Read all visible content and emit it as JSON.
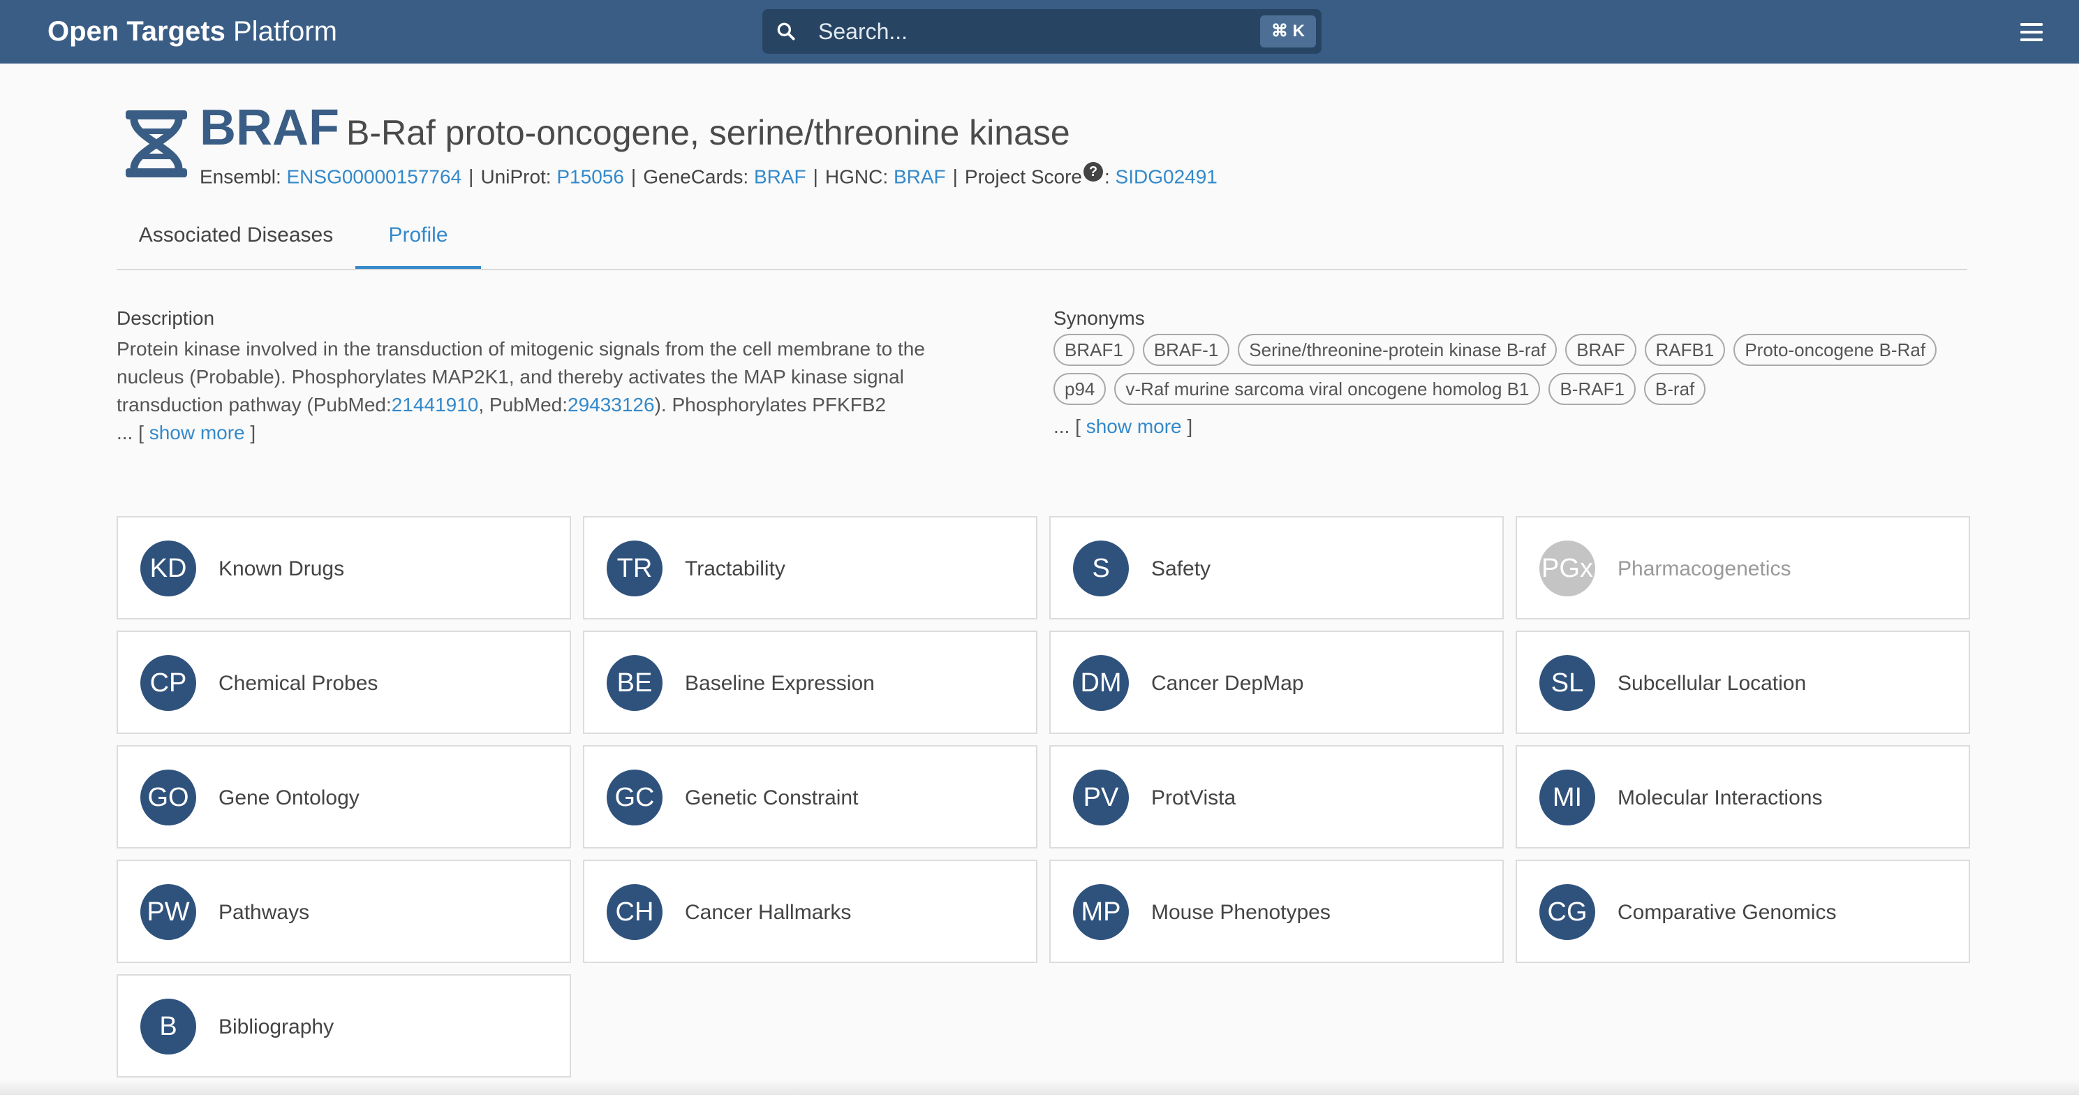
{
  "app": {
    "brand_bold": "Open Targets",
    "brand_light": "Platform"
  },
  "search": {
    "placeholder": "Search...",
    "shortcut": "⌘ K",
    "icon": "search-icon"
  },
  "menu": {
    "icon": "hamburger-menu-icon"
  },
  "target": {
    "icon": "dna-helix-icon",
    "symbol": "BRAF",
    "name": "B-Raf proto-oncogene, serine/threonine kinase",
    "xrefs": {
      "ensembl_label": "Ensembl:",
      "ensembl_id": "ENSG00000157764",
      "uniprot_label": "UniProt:",
      "uniprot_id": "P15056",
      "genecards_label": "GeneCards:",
      "genecards_id": "BRAF",
      "hgnc_label": "HGNC:",
      "hgnc_id": "BRAF",
      "project_score_label": "Project Score",
      "help_glyph": "?",
      "colon": ":",
      "project_score_id": "SIDG02491",
      "separator": "|"
    }
  },
  "tabs": [
    {
      "label": "Associated Diseases",
      "active": false
    },
    {
      "label": "Profile",
      "active": true
    }
  ],
  "description": {
    "title": "Description",
    "line1": "Protein kinase involved in the transduction of mitogenic signals from the cell membrane to the",
    "line2": "nucleus (Probable). Phosphorylates MAP2K1, and thereby activates the MAP kinase signal",
    "line3_a": "transduction pathway (PubMed:",
    "pubmed1": "21441910",
    "line3_b": ", PubMed:",
    "pubmed2": "29433126",
    "line3_c": "). Phosphorylates PFKFB2",
    "more_prefix": "... [ ",
    "more_label": "show more",
    "more_suffix": " ]"
  },
  "synonyms": {
    "title": "Synonyms",
    "items": [
      "BRAF1",
      "BRAF-1",
      "Serine/threonine-protein kinase B-raf",
      "BRAF",
      "RAFB1",
      "Proto-oncogene B-Raf",
      "p94",
      "v-Raf murine sarcoma viral oncogene homolog B1",
      "B-RAF1",
      "B-raf"
    ],
    "more_prefix": "... [ ",
    "more_label": "show more",
    "more_suffix": " ]"
  },
  "sections": [
    {
      "abbr": "KD",
      "label": "Known Drugs",
      "available": true
    },
    {
      "abbr": "TR",
      "label": "Tractability",
      "available": true
    },
    {
      "abbr": "S",
      "label": "Safety",
      "available": true
    },
    {
      "abbr": "PGx",
      "label": "Pharmacogenetics",
      "available": false
    },
    {
      "abbr": "CP",
      "label": "Chemical Probes",
      "available": true
    },
    {
      "abbr": "BE",
      "label": "Baseline Expression",
      "available": true
    },
    {
      "abbr": "DM",
      "label": "Cancer DepMap",
      "available": true
    },
    {
      "abbr": "SL",
      "label": "Subcellular Location",
      "available": true
    },
    {
      "abbr": "GO",
      "label": "Gene Ontology",
      "available": true
    },
    {
      "abbr": "GC",
      "label": "Genetic Constraint",
      "available": true
    },
    {
      "abbr": "PV",
      "label": "ProtVista",
      "available": true
    },
    {
      "abbr": "MI",
      "label": "Molecular Interactions",
      "available": true
    },
    {
      "abbr": "PW",
      "label": "Pathways",
      "available": true
    },
    {
      "abbr": "CH",
      "label": "Cancer Hallmarks",
      "available": true
    },
    {
      "abbr": "MP",
      "label": "Mouse Phenotypes",
      "available": true
    },
    {
      "abbr": "CG",
      "label": "Comparative Genomics",
      "available": true
    },
    {
      "abbr": "B",
      "label": "Bibliography",
      "available": true
    }
  ],
  "colors": {
    "navbar": "#3a5d85",
    "search_bg": "#284463",
    "avatar": "#2f527d",
    "avatar_unavailable": "#c4c4c4",
    "link": "#3489ca",
    "page_bg": "#fafafa"
  }
}
